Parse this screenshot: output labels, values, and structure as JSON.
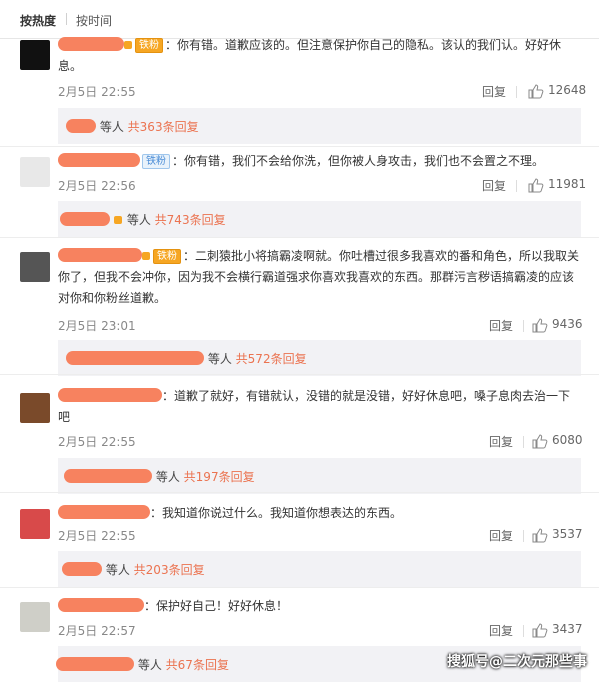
{
  "tabs": {
    "hot": "按热度",
    "time": "按时间"
  },
  "comments": [
    {
      "text": "：你有错。道歉应该的。但注意保护你自己的隐私。该认的我们认。好好休息。",
      "badge": "铁粉",
      "date": "2月5日 22:55",
      "reply_label": "回复",
      "likes": "12648",
      "replies_suffix": "等人",
      "replies_link": "共363条回复"
    },
    {
      "text": "：你有错，我们不会给你洗，但你被人身攻击，我们也不会置之不理。",
      "badge": "铁粉",
      "date": "2月5日 22:56",
      "reply_label": "回复",
      "likes": "11981",
      "replies_suffix": "等人",
      "replies_link": "共743条回复"
    },
    {
      "text": "：二刺猿批小将搞霸凌啊就。你吐槽过很多我喜欢的番和角色，所以我取关你了，但我不会冲你，因为我不会横行霸道强求你喜欢我喜欢的东西。那群污言秽语搞霸凌的应该对你和你粉丝道歉。",
      "badge": "铁粉",
      "date": "2月5日 23:01",
      "reply_label": "回复",
      "likes": "9436",
      "replies_suffix": "等人",
      "replies_link": "共572条回复"
    },
    {
      "text": "：道歉了就好，有错就认，没错的就是没错，好好休息吧，嗓子息肉去治一下吧",
      "date": "2月5日 22:55",
      "reply_label": "回复",
      "likes": "6080",
      "replies_suffix": "等人",
      "replies_link": "共197条回复"
    },
    {
      "text": "：我知道你说过什么。我知道你想表达的东西。",
      "date": "2月5日 22:55",
      "reply_label": "回复",
      "likes": "3537",
      "replies_suffix": "等人",
      "replies_link": "共203条回复"
    },
    {
      "text": "：保护好自己！好好休息！",
      "date": "2月5日 22:57",
      "reply_label": "回复",
      "likes": "3437",
      "replies_suffix": "等人",
      "replies_link": "共67条回复"
    }
  ],
  "watermark": "搜狐号@二次元那些事",
  "colors": {
    "redaction": "#f7825f",
    "link": "#eb7350",
    "reply_bg": "#f2f2f5"
  },
  "icons": {
    "like": "thumbs-up-icon"
  }
}
